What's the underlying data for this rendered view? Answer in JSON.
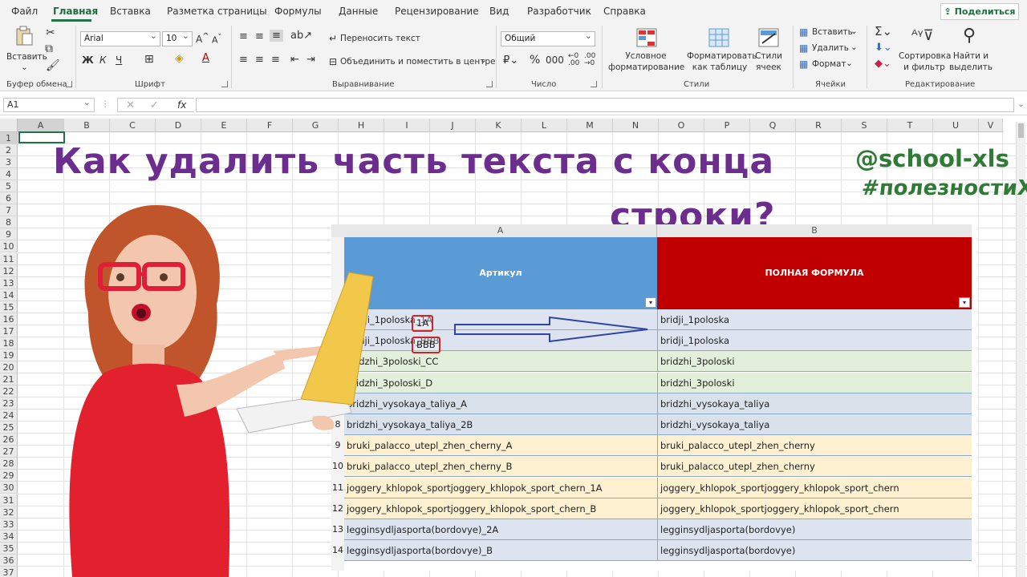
{
  "menu": {
    "tabs": [
      "Файл",
      "Главная",
      "Вставка",
      "Разметка страницы",
      "Формулы",
      "Данные",
      "Рецензирование",
      "Вид",
      "Разработчик",
      "Справка"
    ],
    "active": "Главная",
    "share": "Поделиться"
  },
  "ribbon": {
    "clipboard": {
      "paste": "Вставить",
      "label": "Буфер обмена"
    },
    "font": {
      "name": "Arial",
      "size": "10",
      "bold": "Ж",
      "italic": "К",
      "underline": "Ч",
      "label": "Шрифт"
    },
    "alignment": {
      "wrap": "Переносить текст",
      "merge": "Объединить и поместить в центре",
      "label": "Выравнивание"
    },
    "number": {
      "format": "Общий",
      "label": "Число"
    },
    "styles": {
      "conditional": "Условное\nформатирование",
      "table": "Форматировать\nкак таблицу",
      "cell_styles": "Стили\nячеек",
      "label": "Стили"
    },
    "cells": {
      "insert": "Вставить",
      "delete": "Удалить",
      "format": "Формат",
      "label": "Ячейки"
    },
    "editing": {
      "sort": "Сортировка\nи фильтр",
      "find": "Найти и\nвыделить",
      "label": "Редактирование"
    }
  },
  "formula_bar": {
    "name_box": "A1",
    "fx": "fx",
    "value": ""
  },
  "columns": [
    "A",
    "B",
    "C",
    "D",
    "E",
    "F",
    "G",
    "H",
    "I",
    "J",
    "K",
    "L",
    "M",
    "N",
    "O",
    "P",
    "Q",
    "R",
    "S",
    "T",
    "U",
    "V"
  ],
  "rows": [
    "1",
    "2",
    "3",
    "4",
    "5",
    "6",
    "7",
    "8",
    "9",
    "10",
    "11",
    "12",
    "13",
    "14",
    "15",
    "16",
    "17",
    "18",
    "19",
    "20",
    "21",
    "22",
    "23",
    "24",
    "25",
    "26",
    "27",
    "28",
    "29",
    "30",
    "31",
    "32",
    "33",
    "34",
    "35",
    "36",
    "37"
  ],
  "overlay": {
    "title_line1": "Как удалить часть текста с конца",
    "title_line2": "строки?",
    "handle": "@school-xls",
    "hashtag": "#полезностиXLS"
  },
  "inner_sheet": {
    "col_a": "A",
    "col_b": "B",
    "header_a": "Артикул",
    "header_b": "ПОЛНАЯ ФОРМУЛА",
    "rows": [
      {
        "n": "",
        "a": "bridji_1poloska_1A",
        "b": "bridji_1poloska",
        "color": "#dde4f0"
      },
      {
        "n": "",
        "a": "bridji_1poloska_BBB",
        "b": "bridji_1poloska",
        "color": "#dde4f0"
      },
      {
        "n": "",
        "a": "bridzhi_3poloski_CC",
        "b": "bridzhi_3poloski",
        "color": "#e2efda"
      },
      {
        "n": "",
        "a": "bridzhi_3poloski_D",
        "b": "bridzhi_3poloski",
        "color": "#e2efda"
      },
      {
        "n": "",
        "a": "bridzhi_vysokaya_taliya_A",
        "b": "bridzhi_vysokaya_taliya",
        "color": "#d9e1ea"
      },
      {
        "n": "8",
        "a": "bridzhi_vysokaya_taliya_2B",
        "b": "bridzhi_vysokaya_taliya",
        "color": "#d9e1ea"
      },
      {
        "n": "9",
        "a": "bruki_palacco_utepl_zhen_cherny_A",
        "b": "bruki_palacco_utepl_zhen_cherny",
        "color": "#fdf1d2"
      },
      {
        "n": "10",
        "a": "bruki_palacco_utepl_zhen_cherny_B",
        "b": "bruki_palacco_utepl_zhen_cherny",
        "color": "#fdf1d2"
      },
      {
        "n": "11",
        "a": "joggery_khlopok_sportjoggery_khlopok_sport_chern_1A",
        "b": "joggery_khlopok_sportjoggery_khlopok_sport_chern",
        "color": "#fdf1d2"
      },
      {
        "n": "12",
        "a": "joggery_khlopok_sportjoggery_khlopok_sport_chern_B",
        "b": "joggery_khlopok_sportjoggery_khlopok_sport_chern",
        "color": "#fdf1d2"
      },
      {
        "n": "13",
        "a": "legginsydljasporta(bordovye)_2A",
        "b": "legginsydljasporta(bordovye)",
        "color": "#dde4f0"
      },
      {
        "n": "14",
        "a": "legginsydljasporta(bordovye)_B",
        "b": "legginsydljasporta(bordovye)",
        "color": "#dde4f0"
      }
    ],
    "highlight_1": "1A",
    "highlight_2": "BBB"
  },
  "colors": {
    "accent": "#217346",
    "title": "#6b2e8e",
    "tag": "#2f7a35",
    "header_a": "#5b9bd5",
    "header_b": "#c00000",
    "highlight": "#d2232a",
    "arrow": "#3046a6"
  }
}
